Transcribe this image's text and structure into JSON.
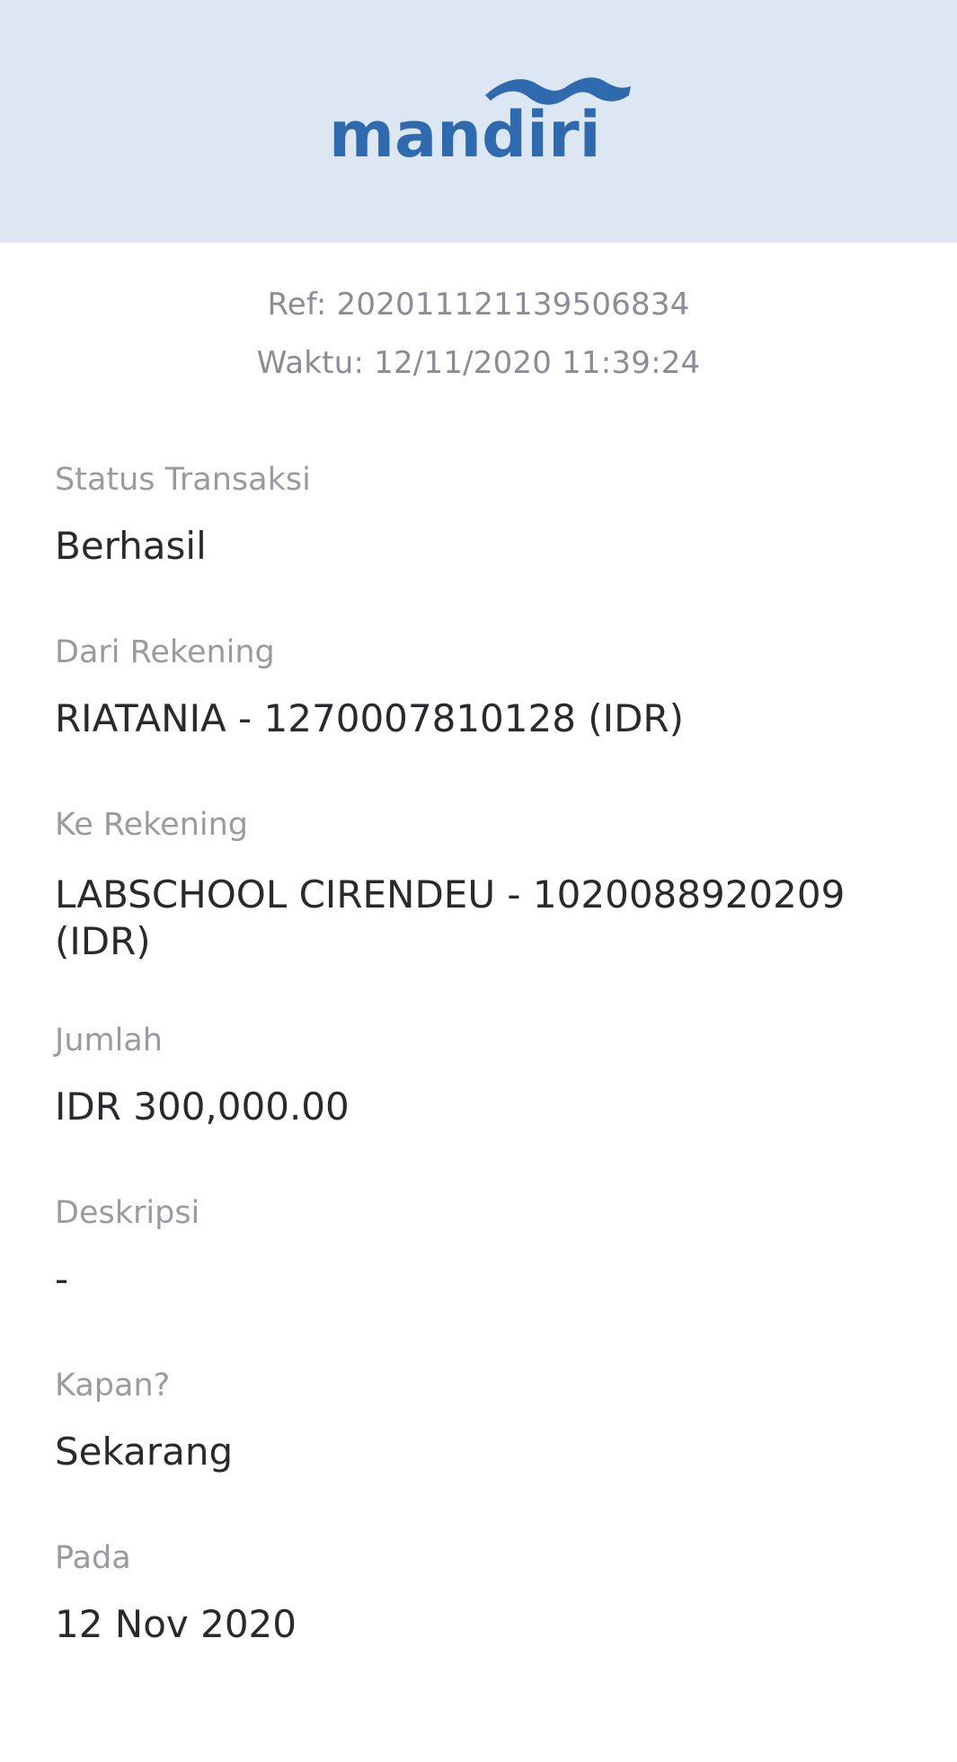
{
  "header": {
    "logo_text": "mandiri",
    "brand_color": "#2e6aad",
    "background_color": "#dce7f3"
  },
  "meta": {
    "ref_label": "Ref: ",
    "ref_value": "202011121139506834",
    "time_label": "Waktu: ",
    "time_value": "12/11/2020 11:39:24"
  },
  "fields": {
    "status": {
      "label": "Status Transaksi",
      "value": "Berhasil"
    },
    "from_account": {
      "label": "Dari Rekening",
      "value": "RIATANIA - 1270007810128 (IDR)"
    },
    "to_account": {
      "label": "Ke Rekening",
      "value": "LABSCHOOL CIRENDEU - 1020088920209 (IDR)"
    },
    "amount": {
      "label": "Jumlah",
      "value": "IDR 300,000.00"
    },
    "description": {
      "label": "Deskripsi",
      "value": "-"
    },
    "when": {
      "label": "Kapan?",
      "value": "Sekarang"
    },
    "on_date": {
      "label": "Pada",
      "value": "12 Nov 2020"
    }
  }
}
